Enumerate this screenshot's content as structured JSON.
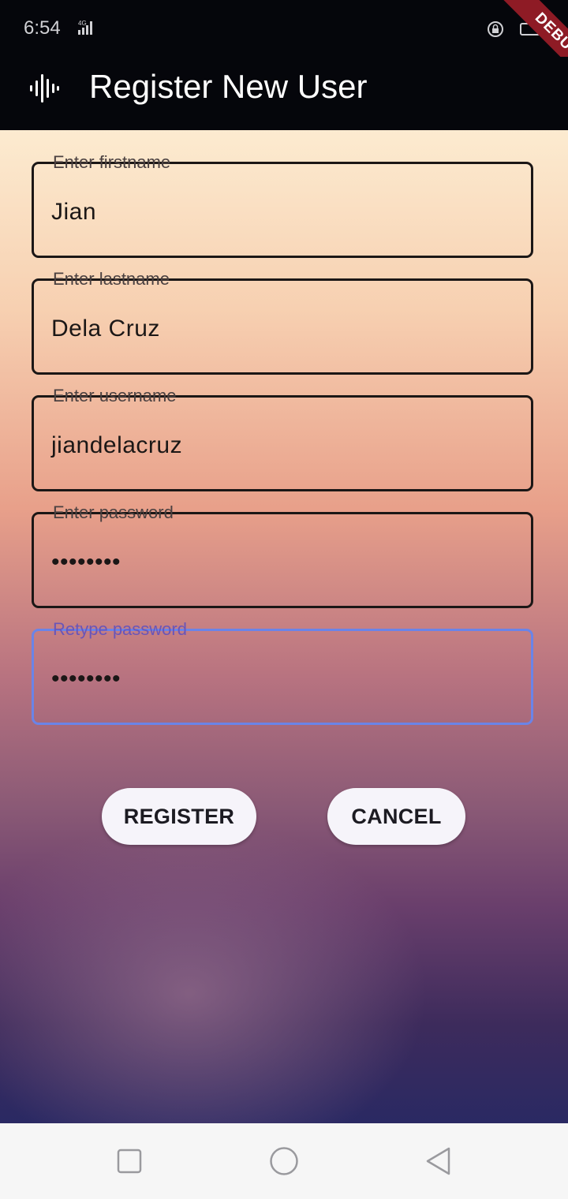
{
  "status_bar": {
    "time": "6:54",
    "network": "4G",
    "icons": [
      "signal-icon",
      "lock-rotation-icon",
      "battery-icon"
    ]
  },
  "debug_banner": "DEBUG",
  "app_bar": {
    "icon": "sound-wave-icon",
    "title": "Register New User"
  },
  "form": {
    "fields": [
      {
        "label": "Enter firstname",
        "value": "Jian"
      },
      {
        "label": "Enter lastname",
        "value": "Dela Cruz"
      },
      {
        "label": "Enter username",
        "value": "jiandelacruz"
      },
      {
        "label": "Enter password",
        "value": "••••••••"
      },
      {
        "label": "Retype password",
        "value": "••••••••"
      }
    ],
    "register_label": "REGISTER",
    "cancel_label": "CANCEL"
  },
  "colors": {
    "focus_border": "#6a84e8",
    "focus_label": "#6a55b8",
    "debug_ribbon": "#8e1b25"
  },
  "nav_bar": {
    "icons": [
      "recents-square-icon",
      "home-circle-icon",
      "back-triangle-icon"
    ]
  }
}
